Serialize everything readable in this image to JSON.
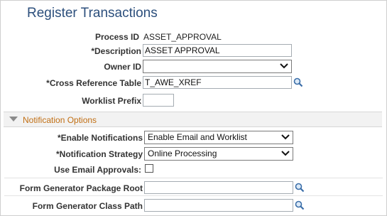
{
  "page": {
    "title": "Register Transactions"
  },
  "fields": {
    "process_id": {
      "label": "Process ID",
      "value": "ASSET_APPROVAL"
    },
    "description": {
      "label": "*Description",
      "value": "ASSET APPROVAL"
    },
    "owner_id": {
      "label": "Owner ID",
      "value": ""
    },
    "cross_ref": {
      "label": "*Cross Reference Table",
      "value": "T_AWE_XREF"
    },
    "worklist_prefix": {
      "label": "Worklist Prefix",
      "value": ""
    }
  },
  "notification": {
    "section_title": "Notification Options",
    "enable": {
      "label": "*Enable Notifications",
      "value": "Enable Email and Worklist"
    },
    "strategy": {
      "label": "*Notification Strategy",
      "value": "Online Processing"
    },
    "email_approvals": {
      "label": "Use Email Approvals:",
      "checked": false
    },
    "pkg_root": {
      "label": "Form Generator Package Root",
      "value": ""
    },
    "class_path": {
      "label": "Form Generator Class Path",
      "value": ""
    }
  },
  "icons": {
    "lookup": "magnifier-icon",
    "dropdown": "chevron-down-icon",
    "collapse": "triangle-down-icon"
  },
  "colors": {
    "title": "#2c4f7c",
    "section_title": "#c16f14"
  }
}
